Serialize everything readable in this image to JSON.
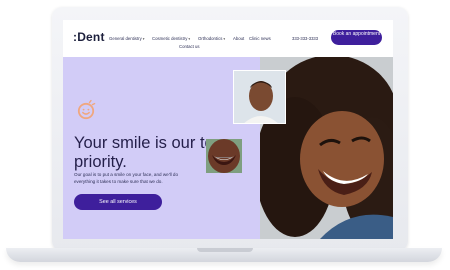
{
  "logo": ":Dent",
  "nav": {
    "items": [
      "General dentistry",
      "Cosmetic dentistry",
      "Orthodontics",
      "About",
      "Clinic news",
      "Contact us"
    ],
    "phone": "333-333-3333",
    "appointment_label": "Book an appointment"
  },
  "hero": {
    "headline": "Your smile is our top priority.",
    "subtext": "Our goal is to put a smile on your face, and we'll do everything it takes to make sure that we do.",
    "cta_label": "See all services"
  },
  "colors": {
    "accent": "#3e1f9c",
    "hero_bg": "#d2ccf7",
    "icon": "#f0a77f",
    "text_dark": "#241f4a"
  },
  "icons": {
    "caret": "chevron-down-icon",
    "hero": "smile-icon"
  }
}
